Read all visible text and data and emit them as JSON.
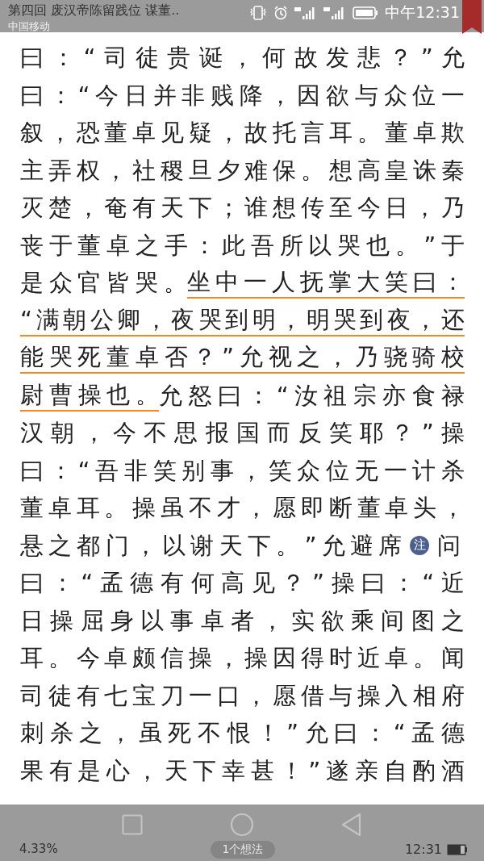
{
  "status_bar": {
    "title": "第四回 废汉帝陈留践位 谋董..",
    "carrier": "中国移动",
    "time": "中午12:31",
    "bookmarked": true
  },
  "body": {
    "lines": [
      {
        "segments": [
          {
            "kind": "text",
            "text": "曰：“司徒贵诞，何故发悲？”允",
            "underlined": false
          }
        ]
      },
      {
        "segments": [
          {
            "kind": "text",
            "text": "曰：“今日并非贱降，因欲与众位一",
            "underlined": false
          }
        ]
      },
      {
        "segments": [
          {
            "kind": "text",
            "text": "叙，恐董卓见疑，故托言耳。董卓欺",
            "underlined": false
          }
        ]
      },
      {
        "segments": [
          {
            "kind": "text",
            "text": "主弄权，社稷旦夕难保。想高皇诛秦",
            "underlined": false
          }
        ]
      },
      {
        "segments": [
          {
            "kind": "text",
            "text": "灭楚，奄有天下；谁想传至今日，乃",
            "underlined": false
          }
        ]
      },
      {
        "segments": [
          {
            "kind": "text",
            "text": "丧于董卓之手：此吾所以哭也。”于",
            "underlined": false
          }
        ]
      },
      {
        "segments": [
          {
            "kind": "text",
            "text": "是众官皆哭。",
            "underlined": false
          },
          {
            "kind": "text",
            "text": "坐中一人抚掌大笑曰：",
            "underlined": true
          }
        ]
      },
      {
        "segments": [
          {
            "kind": "text",
            "text": "“满朝公卿，夜哭到明，明哭到夜，还",
            "underlined": true
          }
        ]
      },
      {
        "segments": [
          {
            "kind": "text",
            "text": "能哭死董卓否？”允视之，乃骁骑校",
            "underlined": true
          }
        ]
      },
      {
        "segments": [
          {
            "kind": "text",
            "text": "尉曹操也。",
            "underlined": true
          },
          {
            "kind": "text",
            "text": "允怒曰：“汝祖宗亦食禄",
            "underlined": false
          }
        ]
      },
      {
        "segments": [
          {
            "kind": "text",
            "text": "汉朝，今不思报国而反笑耶？”操",
            "underlined": false
          }
        ]
      },
      {
        "segments": [
          {
            "kind": "text",
            "text": "曰：“吾非笑别事，笑众位无一计杀",
            "underlined": false
          }
        ]
      },
      {
        "segments": [
          {
            "kind": "text",
            "text": "董卓耳。操虽不才，愿即断董卓头，",
            "underlined": false
          }
        ]
      },
      {
        "segments": [
          {
            "kind": "text",
            "text": "悬之都门，以谢天下。”允避席",
            "underlined": false
          },
          {
            "kind": "note",
            "text": "注"
          },
          {
            "kind": "text",
            "text": "问",
            "underlined": false
          }
        ]
      },
      {
        "segments": [
          {
            "kind": "text",
            "text": "曰：“孟德有何高见？”操曰：“近",
            "underlined": false
          }
        ]
      },
      {
        "segments": [
          {
            "kind": "text",
            "text": "日操屈身以事卓者，实欲乘间图之",
            "underlined": false
          }
        ]
      },
      {
        "segments": [
          {
            "kind": "text",
            "text": "耳。今卓颇信操，操因得时近卓。闻",
            "underlined": false
          }
        ]
      },
      {
        "segments": [
          {
            "kind": "text",
            "text": "司徒有七宝刀一口，愿借与操入相府",
            "underlined": false
          }
        ]
      },
      {
        "segments": [
          {
            "kind": "text",
            "text": "刺杀之，虽死不恨！”允曰：“孟德",
            "underlined": false
          }
        ]
      },
      {
        "segments": [
          {
            "kind": "text",
            "text": "果有是心，天下幸甚！”遂亲自酌酒",
            "underlined": false
          }
        ]
      }
    ]
  },
  "footer": {
    "progress": "4.33%",
    "thoughts": "1个想法",
    "time": "12:31"
  }
}
